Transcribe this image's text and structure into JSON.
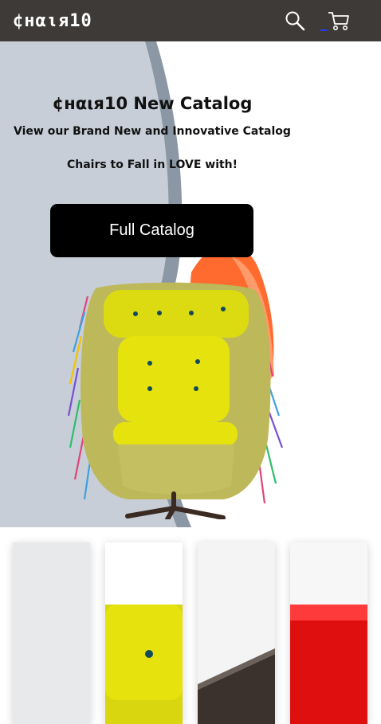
{
  "header": {
    "logo": "¢нαιя10",
    "search_icon": "search-icon",
    "cart_icon": "cart-icon"
  },
  "hero": {
    "title": "¢нαιя10 New Catalog",
    "subtitle": "View our Brand New and Innovative Catalog",
    "tagline": "Chairs to Fall in LOVE with!",
    "cta_label": "Full Catalog"
  },
  "colors": {
    "header_bg": "#3d3a37",
    "hero_panel": "#c7ced8",
    "accent_orange": "#ff6b2e",
    "chair_yellow": "#e5e20d",
    "button_bg": "#000000"
  },
  "thumbnails": [
    {
      "name": "product-thumbnail-1"
    },
    {
      "name": "product-thumbnail-2"
    },
    {
      "name": "product-thumbnail-3"
    },
    {
      "name": "product-thumbnail-4"
    }
  ]
}
